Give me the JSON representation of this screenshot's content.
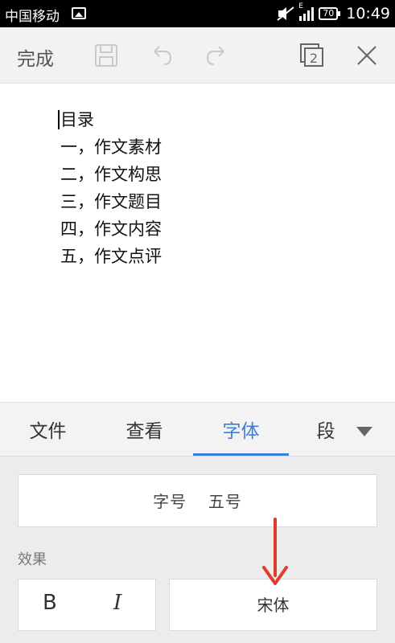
{
  "status_bar": {
    "carrier": "中国移动",
    "signal_label": "E",
    "battery": "70",
    "time": "10:49"
  },
  "toolbar": {
    "done_label": "完成",
    "pages_count": "2",
    "icons": [
      "save-icon",
      "undo-icon",
      "redo-icon",
      "pages-icon",
      "close-icon"
    ]
  },
  "document": {
    "lines": [
      "目录",
      "一，作文素材",
      "二，作文构思",
      "三，作文题目",
      "四，作文内容",
      "五，作文点评"
    ]
  },
  "tabs": {
    "items": [
      "文件",
      "查看",
      "字体",
      "段"
    ],
    "active": "字体",
    "active_color": "#3d7fd6"
  },
  "font_panel": {
    "font_size_label": "字号",
    "font_size_value": "五号",
    "effects_label": "效果",
    "bold_label": "B",
    "italic_label": "I",
    "font_name": "宋体"
  },
  "annotation": {
    "arrow_color": "#e03c2e"
  }
}
